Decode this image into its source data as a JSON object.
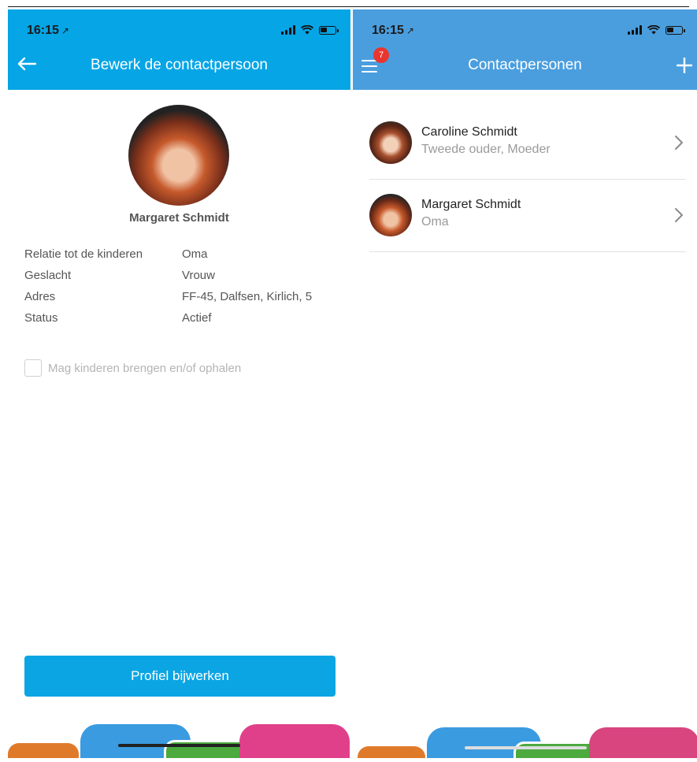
{
  "left": {
    "status": {
      "time": "16:15",
      "location_glyph": "↗"
    },
    "title": "Bewerk de contactpersoon",
    "profile": {
      "name": "Margaret Schmidt"
    },
    "details": [
      {
        "label": "Relatie tot de kinderen",
        "value": "Oma"
      },
      {
        "label": "Geslacht",
        "value": "Vrouw"
      },
      {
        "label": "Adres",
        "value": "FF-45, Dalfsen, Kirlich, 5"
      },
      {
        "label": "Status",
        "value": "Actief"
      }
    ],
    "checkbox_label": "Mag kinderen brengen en/of ophalen",
    "button_label": "Profiel bijwerken",
    "colors": {
      "appbar": "#06a5e6",
      "button": "#0ba5e4"
    }
  },
  "right": {
    "status": {
      "time": "16:15",
      "location_glyph": "↗"
    },
    "title": "Contactpersonen",
    "menu_badge": "7",
    "contacts": [
      {
        "name": "Caroline Schmidt",
        "subtitle": "Tweede ouder, Moeder"
      },
      {
        "name": "Margaret Schmidt",
        "subtitle": "Oma"
      }
    ],
    "colors": {
      "appbar": "#4a9ede",
      "badge": "#e8362e"
    }
  }
}
